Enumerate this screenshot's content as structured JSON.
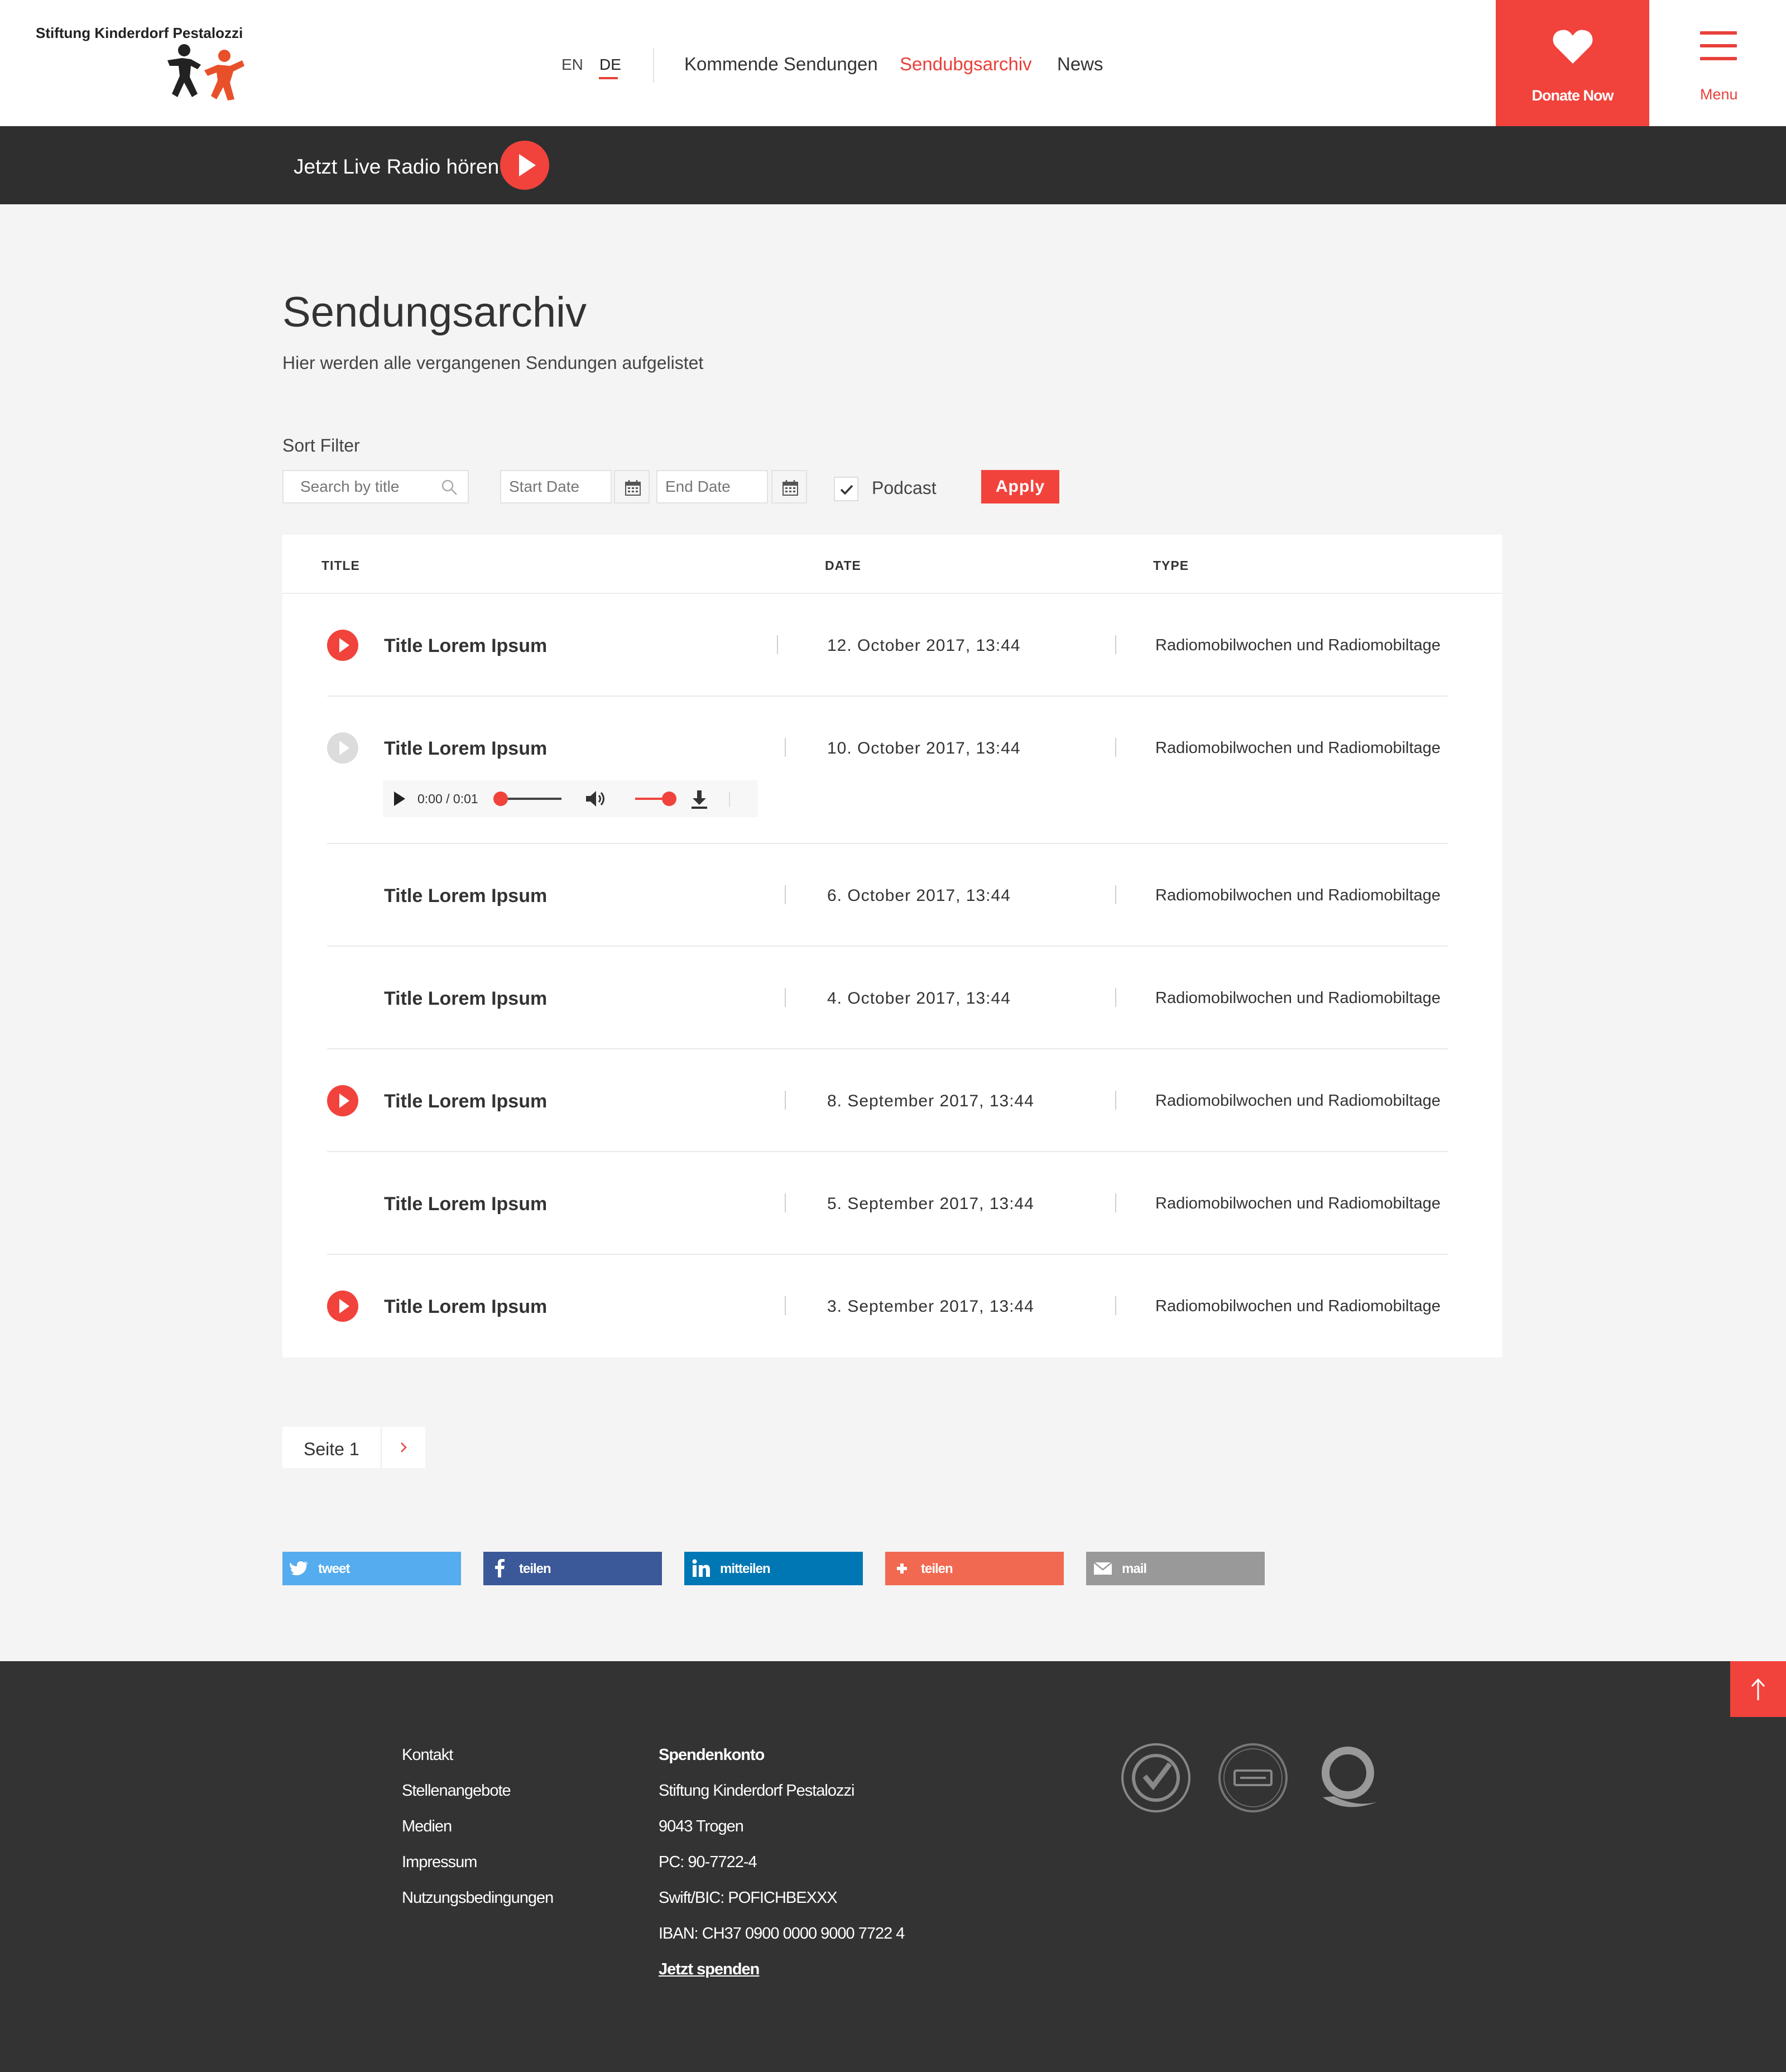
{
  "header": {
    "logo_text": "Stiftung Kinderdorf Pestalozzi",
    "lang_en": "EN",
    "lang_de": "DE",
    "nav": [
      {
        "label": "Kommende Sendungen"
      },
      {
        "label": "Sendubgsarchiv",
        "active": true
      },
      {
        "label": "News"
      }
    ],
    "donate_label": "Donate Now",
    "menu_label": "Menu"
  },
  "livebar": {
    "label": "Jetzt Live Radio hören"
  },
  "main": {
    "title": "Sendungsarchiv",
    "subtitle": "Hier werden alle vergangenen Sendungen aufgelistet"
  },
  "filter": {
    "label": "Sort Filter",
    "search_placeholder": "Search by title",
    "start_placeholder": "Start Date",
    "end_placeholder": "End Date",
    "podcast_label": "Podcast",
    "podcast_checked": true,
    "apply_label": "Apply"
  },
  "table": {
    "headers": {
      "title": "TITLE",
      "date": "DATE",
      "type": "TYPE"
    },
    "rows": [
      {
        "title": "Title Lorem Ipsum",
        "date": "12. October 2017, 13:44",
        "type": "Radiomobilwochen und Radiomobiltage",
        "play": "red"
      },
      {
        "title": "Title Lorem Ipsum",
        "date": "10. October 2017, 13:44",
        "type": "Radiomobilwochen und Radiomobiltage",
        "play": "grey"
      },
      {
        "title": "Title Lorem Ipsum",
        "date": "6. October 2017, 13:44",
        "type": "Radiomobilwochen und Radiomobiltage",
        "play": "none"
      },
      {
        "title": "Title Lorem Ipsum",
        "date": "4. October 2017, 13:44",
        "type": "Radiomobilwochen und Radiomobiltage",
        "play": "none"
      },
      {
        "title": "Title Lorem Ipsum",
        "date": "8. September 2017, 13:44",
        "type": "Radiomobilwochen und Radiomobiltage",
        "play": "red"
      },
      {
        "title": "Title Lorem Ipsum",
        "date": "5. September 2017, 13:44",
        "type": "Radiomobilwochen und Radiomobiltage",
        "play": "none"
      },
      {
        "title": "Title Lorem Ipsum",
        "date": "3. September 2017, 13:44",
        "type": "Radiomobilwochen und Radiomobiltage",
        "play": "red"
      }
    ],
    "player": {
      "time": "0:00 / 0:01",
      "progress": 0.0,
      "volume": 1.0
    }
  },
  "pagination": {
    "label": "Seite 1"
  },
  "share": {
    "twitter": "tweet",
    "facebook": "teilen",
    "linkedin": "mitteilen",
    "googleplus": "teilen",
    "mail": "mail"
  },
  "footer": {
    "links": [
      "Kontakt",
      "Stellenangebote",
      "Medien",
      "Impressum",
      "Nutzungsbedingungen"
    ],
    "bank": {
      "heading": "Spendenkonto",
      "lines": [
        "Stiftung Kinderdorf Pestalozzi",
        "9043 Trogen",
        "PC: 90-7722-4",
        "Swift/BIC: POFICHBEXXX",
        "IBAN: CH37 0900 0000 9000 7722 4"
      ],
      "link": "Jetzt spenden"
    }
  },
  "colors": {
    "accent": "#f1433c",
    "dark_bar": "#2f2f2f",
    "footer_bg": "#333333",
    "page_bg": "#f4f4f4",
    "twitter": "#55acee",
    "facebook": "#3b5998",
    "linkedin": "#0077b5",
    "googleplus": "#f06950",
    "mail": "#999999"
  }
}
